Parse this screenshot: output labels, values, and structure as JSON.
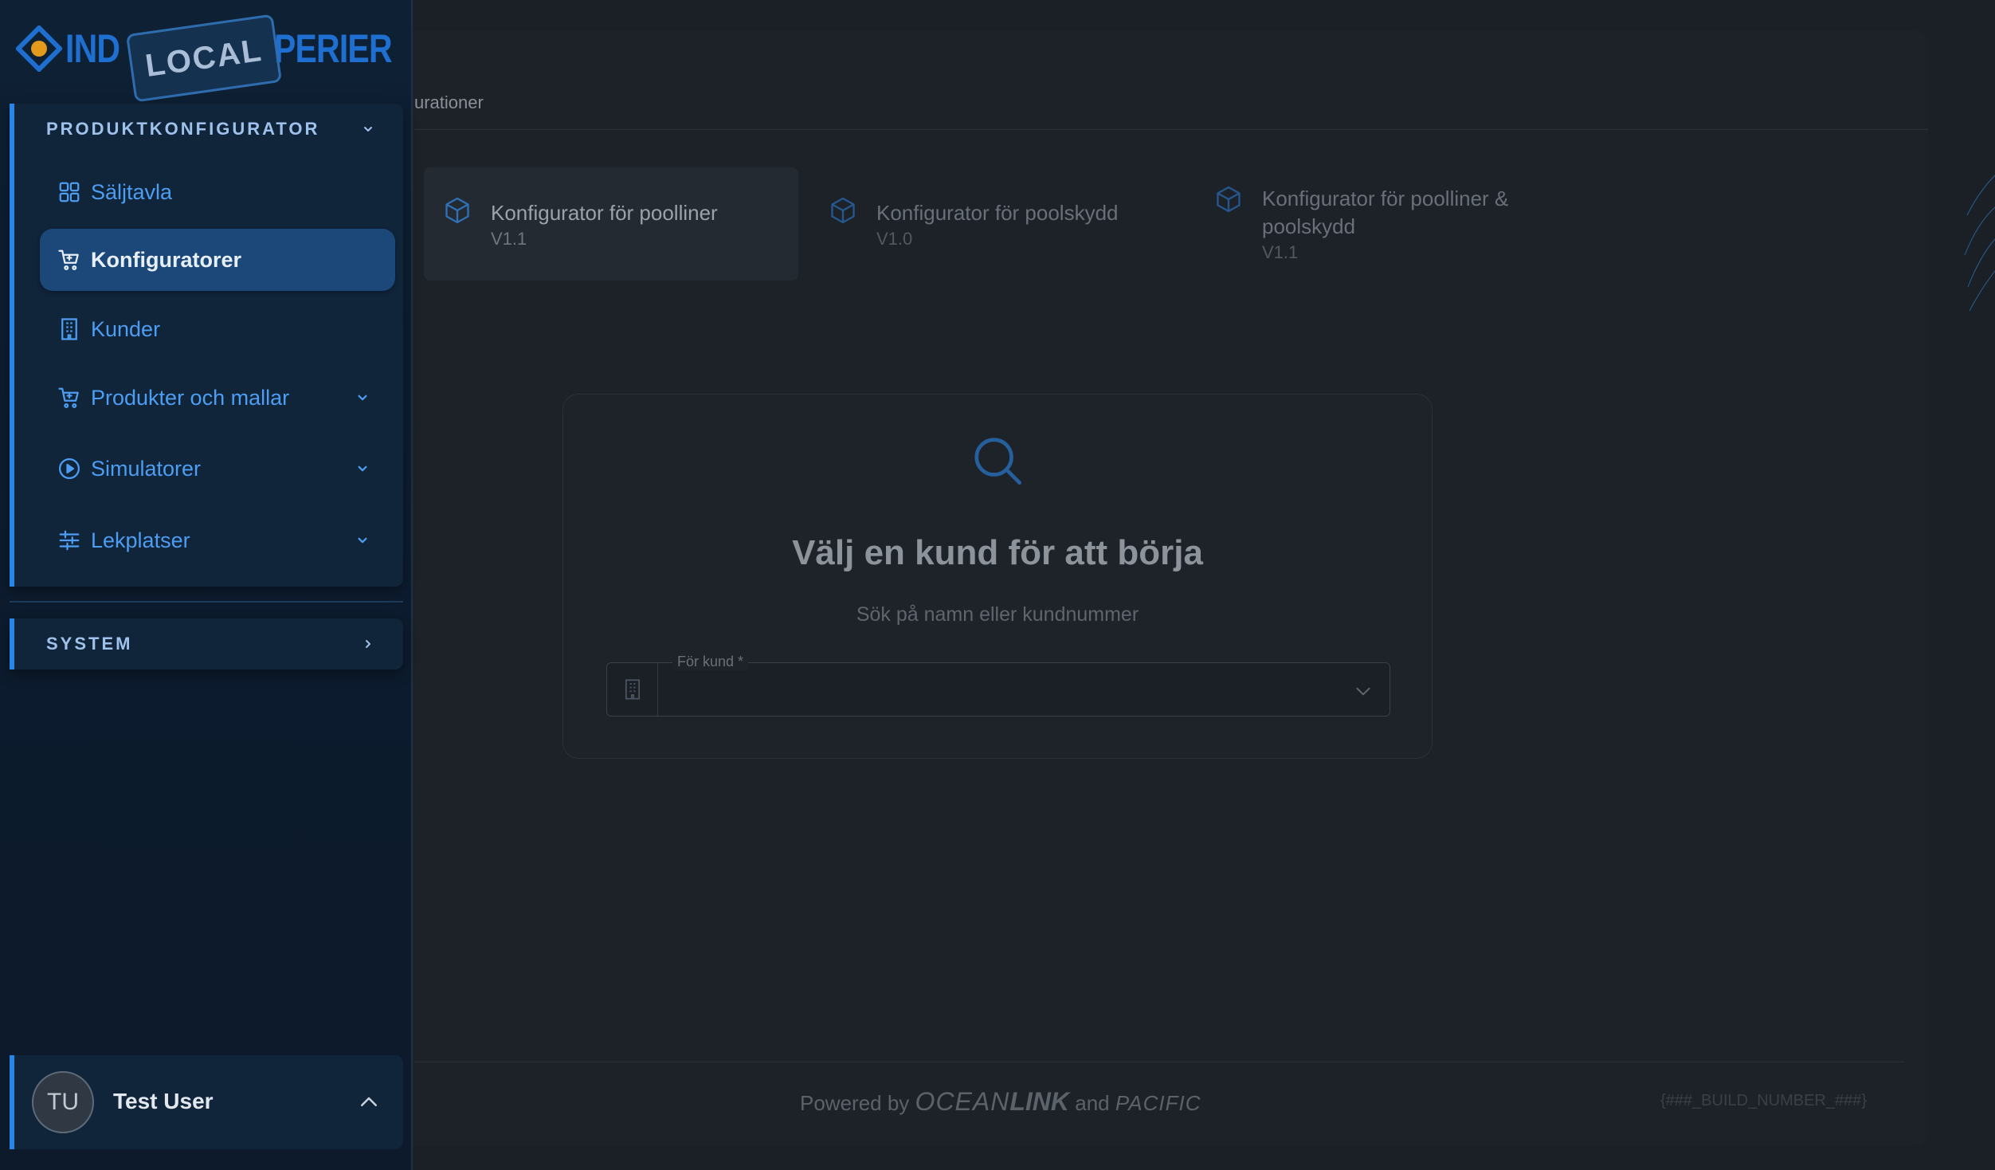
{
  "logo": {
    "left": "IND",
    "badge": "LOCAL",
    "right": "PERIER"
  },
  "sidebar": {
    "section_product": "PRODUKTKONFIGURATOR",
    "items": [
      {
        "label": "Säljtavla",
        "icon": "dashboard-grid-icon"
      },
      {
        "label": "Konfiguratorer",
        "icon": "cart-icon",
        "active": true
      },
      {
        "label": "Kunder",
        "icon": "building-icon"
      },
      {
        "label": "Produkter och mallar",
        "icon": "cart-icon"
      },
      {
        "label": "Simulatorer",
        "icon": "play-circle-icon"
      },
      {
        "label": "Lekplatser",
        "icon": "sliders-icon"
      }
    ],
    "section_system": "SYSTEM"
  },
  "user": {
    "initials": "TU",
    "name": "Test User"
  },
  "breadcrumb": "urationer",
  "configurators": [
    {
      "title": "Konfigurator för poolliner",
      "version": "V1.1",
      "active": true
    },
    {
      "title": "Konfigurator för poolskydd",
      "version": "V1.0"
    },
    {
      "title": "Konfigurator för poolliner & poolskydd",
      "version": "V1.1"
    }
  ],
  "select_card": {
    "title": "Välj en kund för att börja",
    "subtitle": "Sök på namn eller kundnummer",
    "field_label": "För kund *",
    "field_value": ""
  },
  "footer": {
    "powered_by": "Powered by",
    "brand_ocean": "OCEAN",
    "brand_link": "LINK",
    "and": "and",
    "brand_pacific": "PACIFIC",
    "build": "{###_BUILD_NUMBER_###}"
  },
  "colors": {
    "accent": "#2a86e6",
    "nav_text": "#4d9df2",
    "active_bg": "#1b4878"
  }
}
